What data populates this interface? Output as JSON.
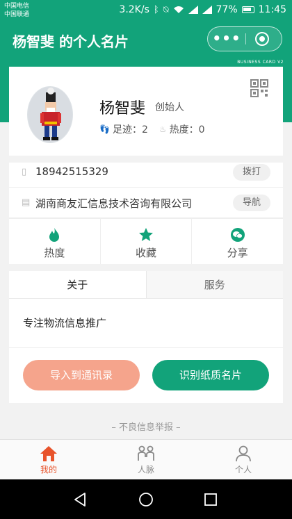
{
  "status_bar": {
    "carrier_1": "中国电信",
    "carrier_2": "中国联通",
    "speed": "3.2K/s",
    "battery": "77%",
    "time": "11:45"
  },
  "header": {
    "title": "杨智斐 的个人名片",
    "more_label": "•••",
    "brand_color": "#12a37a"
  },
  "card": {
    "label": "BUSINESS CARD V2",
    "name": "杨智斐",
    "role": "创始人",
    "footprint_label": "足迹：2",
    "heat_label": "热度：0",
    "phone": "18942515329",
    "call_button": "拨打",
    "company": "湖南商友汇信息技术咨询有限公司",
    "navigate_button": "导航",
    "actions": [
      {
        "label": "热度",
        "icon": "flame-icon"
      },
      {
        "label": "收藏",
        "icon": "star-icon"
      },
      {
        "label": "分享",
        "icon": "wechat-icon"
      }
    ]
  },
  "tabs": {
    "items": [
      "关于",
      "服务"
    ],
    "active": "关于",
    "about_text": "专注物流信息推广",
    "import_button": "导入到通讯录",
    "scan_button": "识别纸质名片",
    "import_color": "#f5a48c"
  },
  "report_link": "– 不良信息举报 –",
  "tabbar": {
    "items": [
      {
        "label": "我的",
        "icon": "home-icon",
        "active": true
      },
      {
        "label": "人脉",
        "icon": "contacts-icon",
        "active": false
      },
      {
        "label": "个人",
        "icon": "person-icon",
        "active": false
      }
    ],
    "active_color": "#e8532b"
  }
}
